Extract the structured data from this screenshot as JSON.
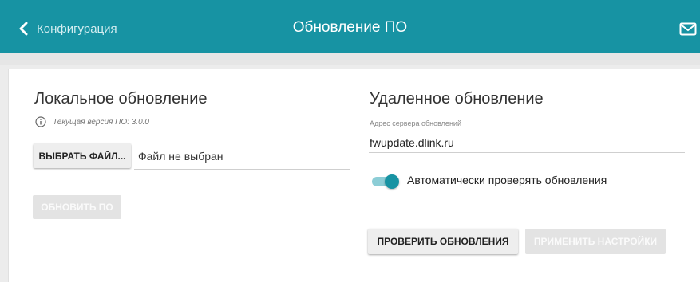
{
  "header": {
    "back_label": "Конфигурация",
    "title": "Обновление ПО",
    "back_icon": "chevron-left-icon",
    "mail_icon": "mail-icon",
    "color": "#1793a3"
  },
  "local": {
    "heading": "Локальное обновление",
    "version_info": "Текущая версия ПО: 3.0.0",
    "info_icon": "info-icon",
    "choose_file_label": "ВЫБРАТЬ ФАЙЛ...",
    "file_status": "Файл не выбран",
    "update_button": "ОБНОВИТЬ ПО"
  },
  "remote": {
    "heading": "Удаленное обновление",
    "server_label": "Адрес сервера обновлений",
    "server_value": "fwupdate.dlink.ru",
    "auto_check_label": "Автоматически проверять обновления",
    "auto_check_enabled": true,
    "check_button": "ПРОВЕРИТЬ ОБНОВЛЕНИЯ",
    "apply_button": "ПРИМЕНИТЬ НАСТРОЙКИ"
  }
}
